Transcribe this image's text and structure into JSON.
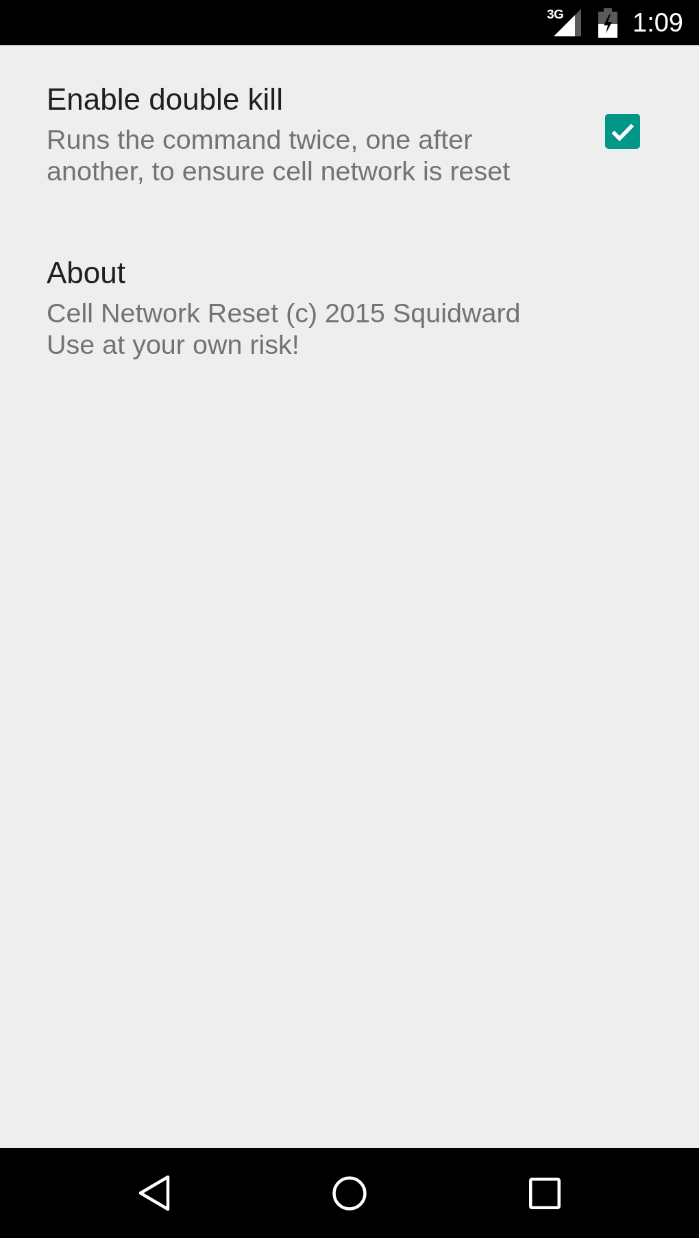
{
  "status_bar": {
    "network": "3G",
    "time": "1:09"
  },
  "preferences": [
    {
      "kind": "checkbox",
      "title": "Enable double kill",
      "summary": "Runs the command twice, one after\nanother, to ensure cell network is reset",
      "checked": true
    },
    {
      "kind": "text",
      "title": "About",
      "summary": "Cell Network Reset (c) 2015 Squidward\nUse at your own risk!"
    }
  ]
}
